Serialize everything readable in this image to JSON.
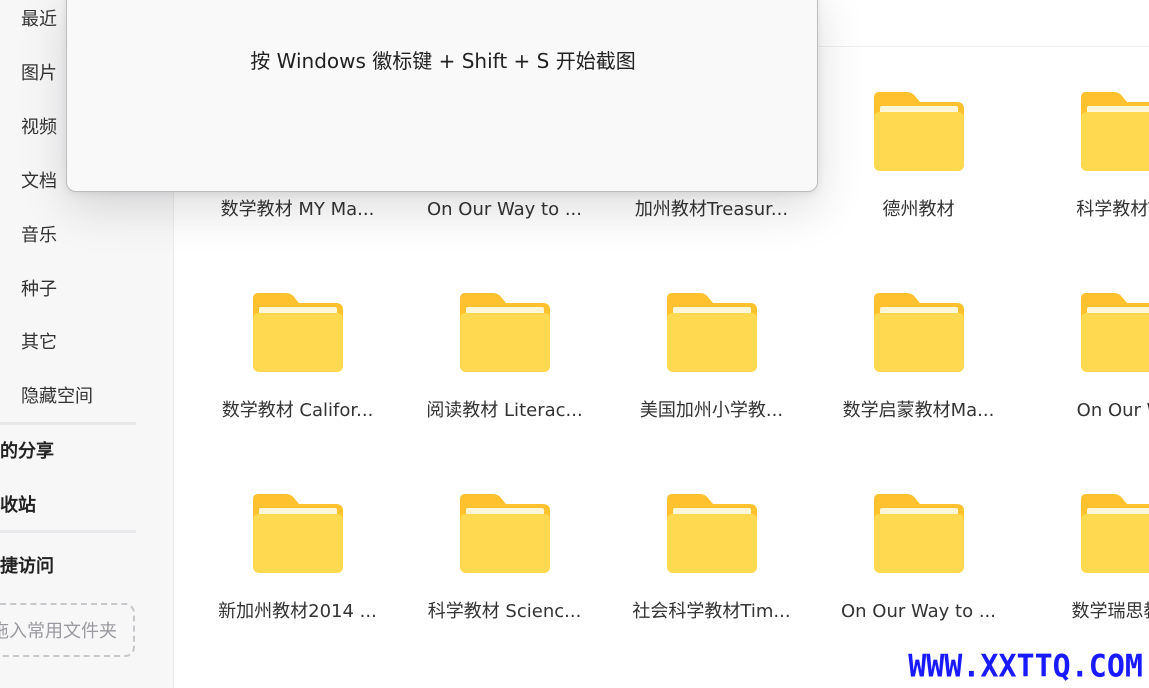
{
  "sidebar": {
    "items": [
      {
        "label": "最近"
      },
      {
        "label": "图片"
      },
      {
        "label": "视频"
      },
      {
        "label": "文档"
      },
      {
        "label": "音乐"
      },
      {
        "label": "种子"
      },
      {
        "label": "其它"
      },
      {
        "label": "隐藏空间"
      }
    ],
    "sections": {
      "my_shares": "的分享",
      "recycle_bin": "收站",
      "quick_access": "捷访问"
    },
    "drop_zone": "拖入常用文件夹"
  },
  "popup": {
    "message": "按 Windows 徽标键 + Shift + S 开始截图"
  },
  "folders": {
    "row1": [
      {
        "name": "数学教材 MY Ma..."
      },
      {
        "name": "On Our Way to ..."
      },
      {
        "name": "加州教材Treasur..."
      },
      {
        "name": "德州教材"
      },
      {
        "name": "科学教材Ter"
      }
    ],
    "row2": [
      {
        "name": "数学教材 Califor..."
      },
      {
        "name": "阅读教材  Literac..."
      },
      {
        "name": "美国加州小学教..."
      },
      {
        "name": "数学启蒙教材Ma..."
      },
      {
        "name": "On Our Wa"
      }
    ],
    "row3": [
      {
        "name": "新加州教材2014 ..."
      },
      {
        "name": "科学教材 Scienc..."
      },
      {
        "name": "社会科学教材Tim..."
      },
      {
        "name": "On Our Way to ..."
      },
      {
        "name": "数学瑞思教材"
      }
    ]
  },
  "colors": {
    "folder_back": "#FFC22E",
    "folder_front": "#FFD94F",
    "watermark": "#1A1AFF"
  },
  "watermark": "WWW.XXTTQ.COM"
}
